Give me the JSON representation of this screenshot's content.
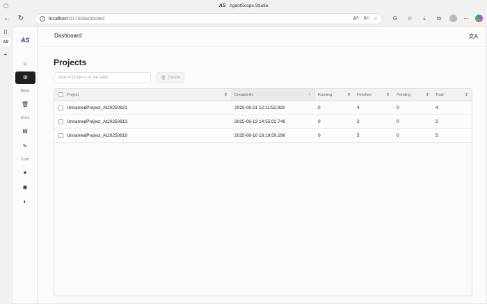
{
  "browser": {
    "window_title": "AgentScope Studio",
    "title_logo": "AS",
    "url_host": "localhost",
    "url_path": ":5173/dashboard",
    "rail_tab_label": "AS"
  },
  "app": {
    "logo": "AS",
    "header_title": "Dashboard",
    "sidebar": {
      "apps_label": "Apps",
      "docs_label": "Docs",
      "cont_label": "Cont"
    },
    "page_title": "Projects",
    "search_placeholder": "Search projects in the table",
    "delete_label": "Delete"
  },
  "table": {
    "columns": [
      "Project",
      "Created At",
      "Running",
      "Finished",
      "Pending",
      "Total"
    ],
    "rows": [
      {
        "project": "UnnamedProject_At20250821",
        "created_at": "2025-08-21 12:11:52.926",
        "running": "0",
        "finished": "4",
        "pending": "0",
        "total": "4"
      },
      {
        "project": "UnnamedProject_At20250813",
        "created_at": "2025-08-13 14:55:02.749",
        "running": "0",
        "finished": "2",
        "pending": "0",
        "total": "2"
      },
      {
        "project": "UnnamedProject_At20250810",
        "created_at": "2025-08-10 18:19:59.296",
        "running": "0",
        "finished": "5",
        "pending": "0",
        "total": "5"
      }
    ]
  },
  "colors": {
    "active_nav_bg": "#1f1f1f",
    "logo_blue": "#1e3a8a"
  }
}
